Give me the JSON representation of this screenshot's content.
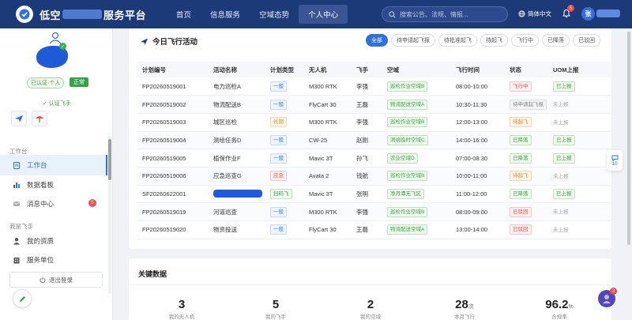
{
  "header": {
    "brand_prefix": "低空",
    "brand_suffix": "服务平台",
    "nav": [
      "首页",
      "信息服务",
      "空域态势",
      "个人中心"
    ],
    "search_placeholder": "搜索公告、法规、情报...",
    "lang": "简体中文",
    "bell_count": "5",
    "avatar_letter": "张"
  },
  "sidebar": {
    "tag_cert": "已认证·个人",
    "tag_normal": "正常",
    "cert_pilot": "✓ 认证飞手",
    "section_work": "工作台",
    "section_pilot": "我是飞手",
    "items": [
      {
        "label": "工作台"
      },
      {
        "label": "数据看板"
      },
      {
        "label": "消息中心",
        "badge": "5"
      },
      {
        "label": "我的资质"
      },
      {
        "label": "服务单位"
      }
    ],
    "logout": "退出登录"
  },
  "activity": {
    "title": "今日飞行活动",
    "filters": [
      "全部",
      "待申请起飞报",
      "待批准起飞",
      "待起飞",
      "飞行中",
      "已降落",
      "已驳回"
    ],
    "columns": [
      "计划编号",
      "活动名称",
      "计划类型",
      "无人机",
      "飞手",
      "空域",
      "飞行时间",
      "状态",
      "UOM上报"
    ],
    "rows": [
      {
        "id": "FP20260519001",
        "name": "电力巡检A",
        "type": "一般",
        "drone": "M300 RTK",
        "pilot": "李强",
        "airspace": "巡检作业空域B",
        "time": "08:00-10:00",
        "status": "飞行中",
        "uom": "已上报"
      },
      {
        "id": "FP20260519002",
        "name": "物流配送B",
        "type": "一般",
        "drone": "FlyCart 30",
        "pilot": "王磊",
        "airspace": "物流配送空域A",
        "time": "10:30-11:30",
        "status": "待申请起飞报",
        "uom": "未上报"
      },
      {
        "id": "FP20260519003",
        "name": "城区巡检",
        "type": "长期",
        "drone": "M300 RTK",
        "pilot": "李强",
        "airspace": "巡检作业空域B",
        "time": "12:00-13:00",
        "status": "待起飞",
        "uom": "未上报"
      },
      {
        "id": "FP20260519004",
        "name": "测绘任务D",
        "type": "一般",
        "drone": "CW-25",
        "pilot": "赵刚",
        "airspace": "测绘临时空域C",
        "time": "14:00-16:00",
        "status": "已降落",
        "uom": "已上报"
      },
      {
        "id": "FP20260519005",
        "name": "植保作业F",
        "type": "一般",
        "drone": "Mavic 3T",
        "pilot": "孙飞",
        "airspace": "农业空域D",
        "time": "07:00-08:30",
        "status": "已降落",
        "uom": "已上报"
      },
      {
        "id": "FP20260519006",
        "name": "应急巡查G",
        "type": "应急",
        "drone": "Avata 2",
        "pilot": "钱航",
        "airspace": "巡检作业空域B",
        "time": "10:00-11:00",
        "status": "待起飞",
        "uom": "未上报"
      },
      {
        "id": "SF20260622001",
        "name": "",
        "type": "扫码飞",
        "drone": "Mavic 3T",
        "pilot": "张明",
        "airspace": "净月潭无飞区",
        "time": "11:00-12:00",
        "status": "已降落",
        "uom": "已上报"
      },
      {
        "id": "FP20260519019",
        "name": "河道巡查",
        "type": "一般",
        "drone": "M300 RTK",
        "pilot": "李强",
        "airspace": "巡检作业空域B",
        "time": "08:00-09:00",
        "status": "已驳回",
        "uom": "未上报"
      },
      {
        "id": "FP20260519020",
        "name": "物资投送",
        "type": "一般",
        "drone": "FlyCart 30",
        "pilot": "王磊",
        "airspace": "物流配送空域A",
        "time": "13:00-14:00",
        "status": "已驳回",
        "uom": "未上报"
      }
    ]
  },
  "key_data": {
    "title": "关键数据",
    "stats": [
      {
        "num": "3",
        "unit": "",
        "label": "我的无人机"
      },
      {
        "num": "5",
        "unit": "",
        "label": "我的飞手"
      },
      {
        "num": "2",
        "unit": "",
        "label": "我的空域"
      },
      {
        "num": "28",
        "unit": "次",
        "label": "本月飞行"
      },
      {
        "num": "96.2",
        "unit": "%",
        "label": "合规率"
      }
    ]
  },
  "float": {
    "count": "10"
  },
  "chat_badge": "3",
  "colors": {
    "header": "#1d3a78",
    "accent": "#2f6fde",
    "green": "#35a24a",
    "red": "#e55050"
  }
}
